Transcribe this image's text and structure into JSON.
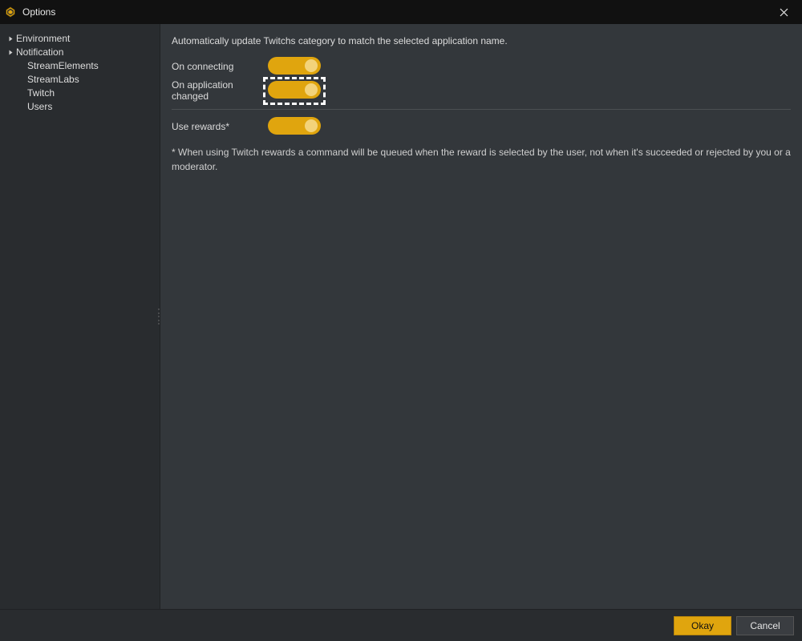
{
  "window": {
    "title": "Options"
  },
  "sidebar": {
    "items": [
      {
        "label": "Environment",
        "expandable": true
      },
      {
        "label": "Notification",
        "expandable": true
      },
      {
        "label": "StreamElements",
        "expandable": false
      },
      {
        "label": "StreamLabs",
        "expandable": false
      },
      {
        "label": "Twitch",
        "expandable": false
      },
      {
        "label": "Users",
        "expandable": false
      }
    ]
  },
  "main": {
    "description": "Automatically update Twitchs category to match the selected application name.",
    "toggles": {
      "on_connecting": {
        "label": "On connecting",
        "value": true
      },
      "on_app_changed": {
        "label": "On application changed",
        "value": true,
        "highlighted": true
      },
      "use_rewards": {
        "label": "Use rewards*",
        "value": true
      }
    },
    "footnote": "* When using Twitch rewards a command will be queued when the reward is selected by the user, not when it's succeeded or rejected by you or a moderator."
  },
  "footer": {
    "okay_label": "Okay",
    "cancel_label": "Cancel"
  },
  "colors": {
    "accent": "#e0a50e"
  }
}
